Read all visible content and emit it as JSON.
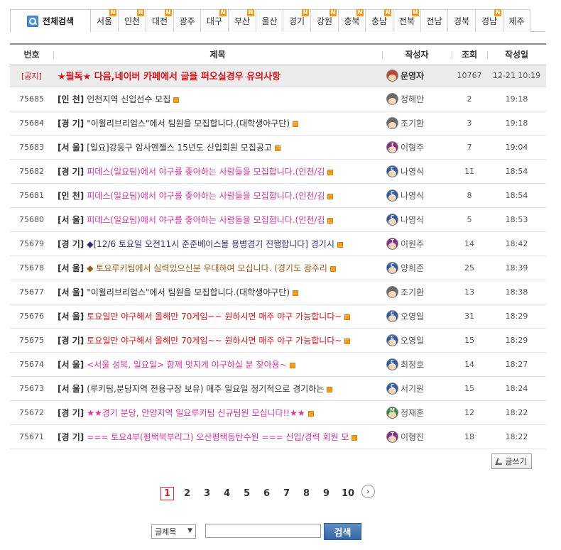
{
  "tabs": {
    "all_label": "전체검색",
    "regions": [
      {
        "label": "서울",
        "new": true
      },
      {
        "label": "인천",
        "new": true
      },
      {
        "label": "대전",
        "new": true
      },
      {
        "label": "광주",
        "new": false
      },
      {
        "label": "대구",
        "new": true
      },
      {
        "label": "부산",
        "new": true
      },
      {
        "label": "울산",
        "new": false
      },
      {
        "label": "경기",
        "new": true
      },
      {
        "label": "강원",
        "new": true
      },
      {
        "label": "충북",
        "new": true
      },
      {
        "label": "충남",
        "new": true
      },
      {
        "label": "전북",
        "new": true
      },
      {
        "label": "전남",
        "new": false
      },
      {
        "label": "경북",
        "new": false
      },
      {
        "label": "경남",
        "new": true
      },
      {
        "label": "제주",
        "new": false
      }
    ],
    "new_badge": "N"
  },
  "table": {
    "headers": {
      "num": "번호",
      "title": "제목",
      "author": "작성자",
      "views": "조회",
      "date": "작성일"
    },
    "notice": {
      "label": "[공지]",
      "title": "★필독★ 다음,네이버 카페에서 글을 퍼오실경우 유의사항",
      "author": "운영자",
      "author_cap": "",
      "views": "10767",
      "date": "12-21 10:19"
    },
    "rows": [
      {
        "num": "75685",
        "region": "[인 천]",
        "title": "인천지역 신입선수 모집",
        "color": "dark",
        "cap": "",
        "av": "d",
        "author": "정해안",
        "views": "2",
        "date": "19:18"
      },
      {
        "num": "75684",
        "region": "[경 기]",
        "title": "\"이윌리브리엄스\"에서 팀원을 모집합니다.(대학생야구단)",
        "color": "dark",
        "cap": "",
        "av": "d",
        "author": "조기환",
        "views": "3",
        "date": "19:18"
      },
      {
        "num": "75683",
        "region": "[서 울]",
        "title": "[일요]강동구 암사엔젤스 15년도 신입회원 모집공고",
        "color": "dark",
        "cap": "T",
        "av": "t",
        "author": "이형주",
        "views": "7",
        "date": "19:04"
      },
      {
        "num": "75682",
        "region": "[경 기]",
        "title": "피데스(일요팀)에서 야구를 좋아하는 사람들을 모집합니다.(인천/김",
        "color": "pink",
        "cap": "C",
        "av": "c",
        "author": "나영식",
        "views": "11",
        "date": "18:54"
      },
      {
        "num": "75681",
        "region": "[인 천]",
        "title": "피데스(일요팀)에서 야구를 좋아하는 사람들을 모집합니다.(인천/김",
        "color": "pink",
        "cap": "C",
        "av": "c",
        "author": "나영식",
        "views": "8",
        "date": "18:54"
      },
      {
        "num": "75680",
        "region": "[서 울]",
        "title": "피데스(일요팀)에서 야구를 좋아하는 사람들을 모집합니다.(인천/김",
        "color": "pink",
        "cap": "C",
        "av": "c",
        "author": "나영식",
        "views": "5",
        "date": "18:53"
      },
      {
        "num": "75679",
        "region": "[경 기]",
        "title": "◆[12/6 토요일 오전11시 준준베이스볼 용병경기 진행합니다] 경기시",
        "color": "navy",
        "cap": "T",
        "av": "t",
        "author": "이원주",
        "views": "14",
        "date": "18:42"
      },
      {
        "num": "75678",
        "region": "[서 울]",
        "title": "◆ 토요루키팀에서 실력있으신분 우대하여 모십니다. (경기도 광주리",
        "color": "brown",
        "cap": "C",
        "av": "c",
        "author": "양희준",
        "views": "25",
        "date": "18:39"
      },
      {
        "num": "75677",
        "region": "[서 울]",
        "title": "\"이윌리브리엄스\"에서 팀원을 모집합니다.(대학생야구단)",
        "color": "dark",
        "cap": "",
        "av": "d",
        "author": "조기환",
        "views": "13",
        "date": "18:38"
      },
      {
        "num": "75676",
        "region": "[서 울]",
        "title": "토요일만 야구해서 올해만 70게임~~ 원하시면 매주 야구 가능합니다~",
        "color": "red",
        "cap": "C",
        "av": "c",
        "author": "오영일",
        "views": "31",
        "date": "18:29"
      },
      {
        "num": "75675",
        "region": "[경 기]",
        "title": "토요일만 야구해서 올해만 70게임~~ 원하시면 매주 야구 가능합니다~",
        "color": "red",
        "cap": "C",
        "av": "c",
        "author": "오영일",
        "views": "15",
        "date": "18:29"
      },
      {
        "num": "75674",
        "region": "[서 울]",
        "title": "<서울 성북, 일요일> 함께 멋지게 야구하실 분 찾아용~",
        "color": "pink",
        "cap": "C",
        "av": "c",
        "author": "최정호",
        "views": "14",
        "date": "18:27"
      },
      {
        "num": "75673",
        "region": "[서 울]",
        "title": "(루키팀,분당지역 전용구장 보유) 매주 일요일 정기적으로 경기하는",
        "color": "dark",
        "cap": "C",
        "av": "c",
        "author": "서기원",
        "views": "15",
        "date": "18:24"
      },
      {
        "num": "75672",
        "region": "[경 기]",
        "title": "★★경기 분당, 안양지역 일요루키팀 신규팀원 모십니다!!★★",
        "color": "pink",
        "cap": "M",
        "av": "m",
        "author": "정재훈",
        "views": "12",
        "date": "18:22"
      },
      {
        "num": "75671",
        "region": "[경 기]",
        "title": "=== 토요4부(평택북부리그) 오산평택동탄수원 === 신입/경력 회원 모",
        "color": "pink",
        "cap": "T",
        "av": "t",
        "author": "이형진",
        "views": "18",
        "date": "18:22"
      }
    ]
  },
  "write_button": "글쓰기",
  "pagination": {
    "pages": [
      "1",
      "2",
      "3",
      "4",
      "5",
      "6",
      "7",
      "8",
      "9",
      "10"
    ],
    "current": "1",
    "next": "›"
  },
  "search": {
    "field_option": "글제목",
    "query": "",
    "button": "검색"
  },
  "colors": {
    "accent_red": "#e0141a",
    "pink": "#d6339c",
    "navy": "#2e2a7a",
    "brown": "#a05a14",
    "search_blue": "#3566a8",
    "new_badge": "#f39c12"
  }
}
